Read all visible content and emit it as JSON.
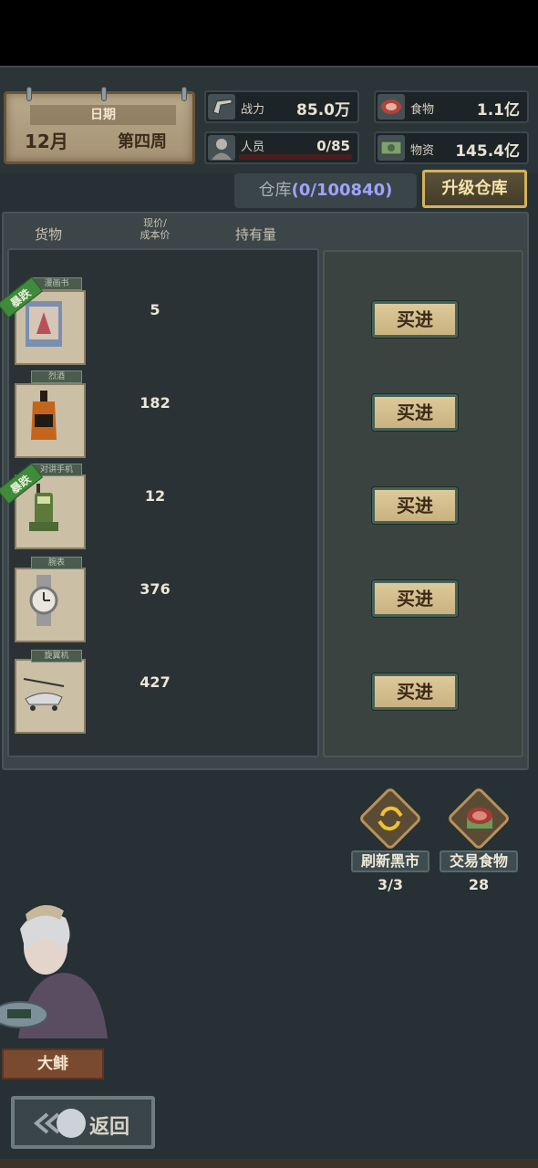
{
  "header": {
    "date_label": "日期",
    "month": "12月",
    "week": "第四周",
    "combat_label": "战力",
    "combat_value": "85.0万",
    "staff_label": "人员",
    "staff_value": "0/85",
    "food_label": "食物",
    "food_value": "1.1亿",
    "supplies_label": "物资",
    "supplies_value": "145.4亿"
  },
  "warehouse": {
    "label": "仓库",
    "count": "(0/100840)",
    "upgrade_label": "升级仓库"
  },
  "table": {
    "col_goods": "货物",
    "col_price_line1": "现价/",
    "col_price_line2": "成本价",
    "col_holding": "持有量",
    "buy_label": "买进",
    "rows": [
      {
        "name": "漫画书",
        "price": "5",
        "tag": "暴跌",
        "icon": "magazine-icon"
      },
      {
        "name": "烈酒",
        "price": "182",
        "tag": "",
        "icon": "whiskey-bottle-icon"
      },
      {
        "name": "对讲手机",
        "price": "12",
        "tag": "暴跌",
        "icon": "walkie-talkie-icon"
      },
      {
        "name": "腕表",
        "price": "376",
        "tag": "",
        "icon": "wristwatch-icon"
      },
      {
        "name": "旋翼机",
        "price": "427",
        "tag": "",
        "icon": "gyrocopter-icon"
      }
    ]
  },
  "actions": {
    "refresh_label": "刷新黑市",
    "refresh_count": "3/3",
    "trade_label": "交易食物",
    "trade_count": "28"
  },
  "character": {
    "name": "大鲱"
  },
  "back_label": "返回"
}
